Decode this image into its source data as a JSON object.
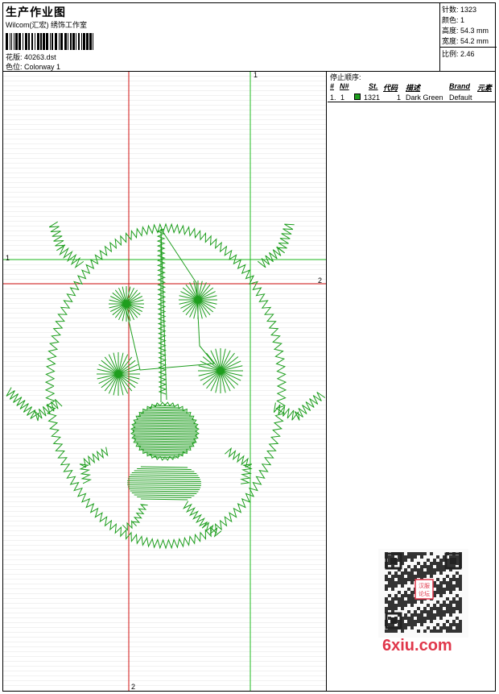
{
  "header": {
    "title": "生产作业图",
    "subtitle": "Wilcom(汇宏) 绣饰工作室",
    "design_label": "花版:",
    "design_value": "40263.dst",
    "color_label": "色位:",
    "color_value": "Colorway 1"
  },
  "stats": {
    "stitches": "针数: 1323",
    "colors": "颜色: 1",
    "height": "高度: 54.3 mm",
    "width": "宽度: 54.2 mm",
    "scale": "比例: 2.46"
  },
  "axes": {
    "green_v": "1",
    "green_h": "1",
    "red_h": "2",
    "red_v": "2"
  },
  "stop_sequence": {
    "title": "停止顺序:",
    "headers": {
      "hash": "#",
      "no": "N#",
      "st": "St.",
      "code": "代码",
      "desc": "描述",
      "brand": "Brand",
      "elem": "元素"
    },
    "row": {
      "hash": "1.",
      "no": "1",
      "st": "1321",
      "code": "1",
      "desc": "Dark Green",
      "brand": "Default"
    }
  },
  "watermark": {
    "seal": "汉服论坛",
    "site": "6xiu.com"
  },
  "colors": {
    "thread": "#1e9e1e",
    "red_axis": "#d01010",
    "green_axis": "#22bb22",
    "brand": "#e0364a"
  }
}
